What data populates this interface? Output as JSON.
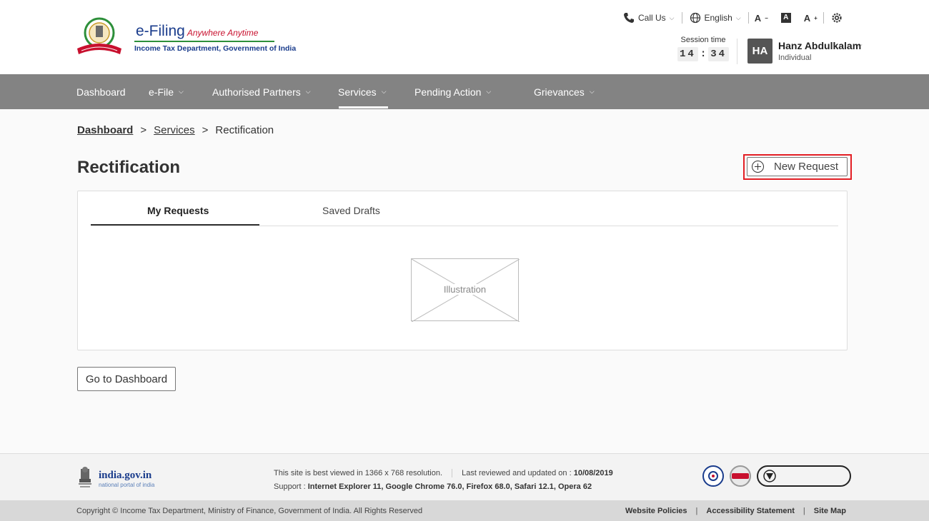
{
  "header": {
    "brand_title": "e-Filing",
    "brand_tagline": "Anywhere Anytime",
    "brand_subtitle": "Income Tax Department, Government of India",
    "call_us": "Call Us",
    "language": "English",
    "font_decrease": "A",
    "font_reset": "A",
    "font_increase": "A",
    "session_label": "Session time",
    "session_minutes": "14",
    "session_seconds": "34",
    "session_colon": ":",
    "avatar_initials": "HA",
    "user_name": "Hanz Abdulkalam",
    "user_role": "Individual"
  },
  "nav": {
    "items": [
      {
        "label": "Dashboard"
      },
      {
        "label": "e-File"
      },
      {
        "label": "Authorised Partners"
      },
      {
        "label": "Services"
      },
      {
        "label": "Pending Action"
      },
      {
        "label": "Grievances"
      }
    ],
    "active": "Services"
  },
  "breadcrumb": {
    "home": "Dashboard",
    "sep1": ">",
    "services": "Services",
    "sep2": ">",
    "current": "Rectification"
  },
  "page": {
    "title": "Rectification",
    "new_request_label": "New Request",
    "tabs": [
      {
        "label": "My Requests",
        "active": true
      },
      {
        "label": "Saved Drafts",
        "active": false
      }
    ],
    "illustration_label": "Illustration",
    "go_to_dashboard_label": "Go to Dashboard"
  },
  "footer": {
    "gov_title": "india.gov.in",
    "gov_sub": "national portal of india",
    "resolution_note": "This site is best viewed in 1366 x 768 resolution.",
    "last_reviewed_label": "Last reviewed and updated on : ",
    "last_reviewed_date": "10/08/2019",
    "support_label": "Support : ",
    "support_browsers": "Internet Explorer 11, Google Chrome 76.0,  Firefox 68.0, Safari 12.1, Opera 62",
    "copyright": "Copyright © Income Tax Department, Ministry of Finance, Government of India. All Rights Reserved",
    "links": [
      "Website Policies",
      "Accessibility Statement",
      "Site Map"
    ],
    "link_sep": "|"
  },
  "colors": {
    "nav_bg": "#838383",
    "brand_blue": "#1a3c8c",
    "highlight_red": "#e31e24",
    "footer_bg": "#f3f3f3",
    "copyright_bg": "#d8d8d8"
  },
  "icons": {
    "call": "phone-icon",
    "language": "globe-icon",
    "settings": "settings-icon",
    "new_request": "plus-circle-icon"
  }
}
